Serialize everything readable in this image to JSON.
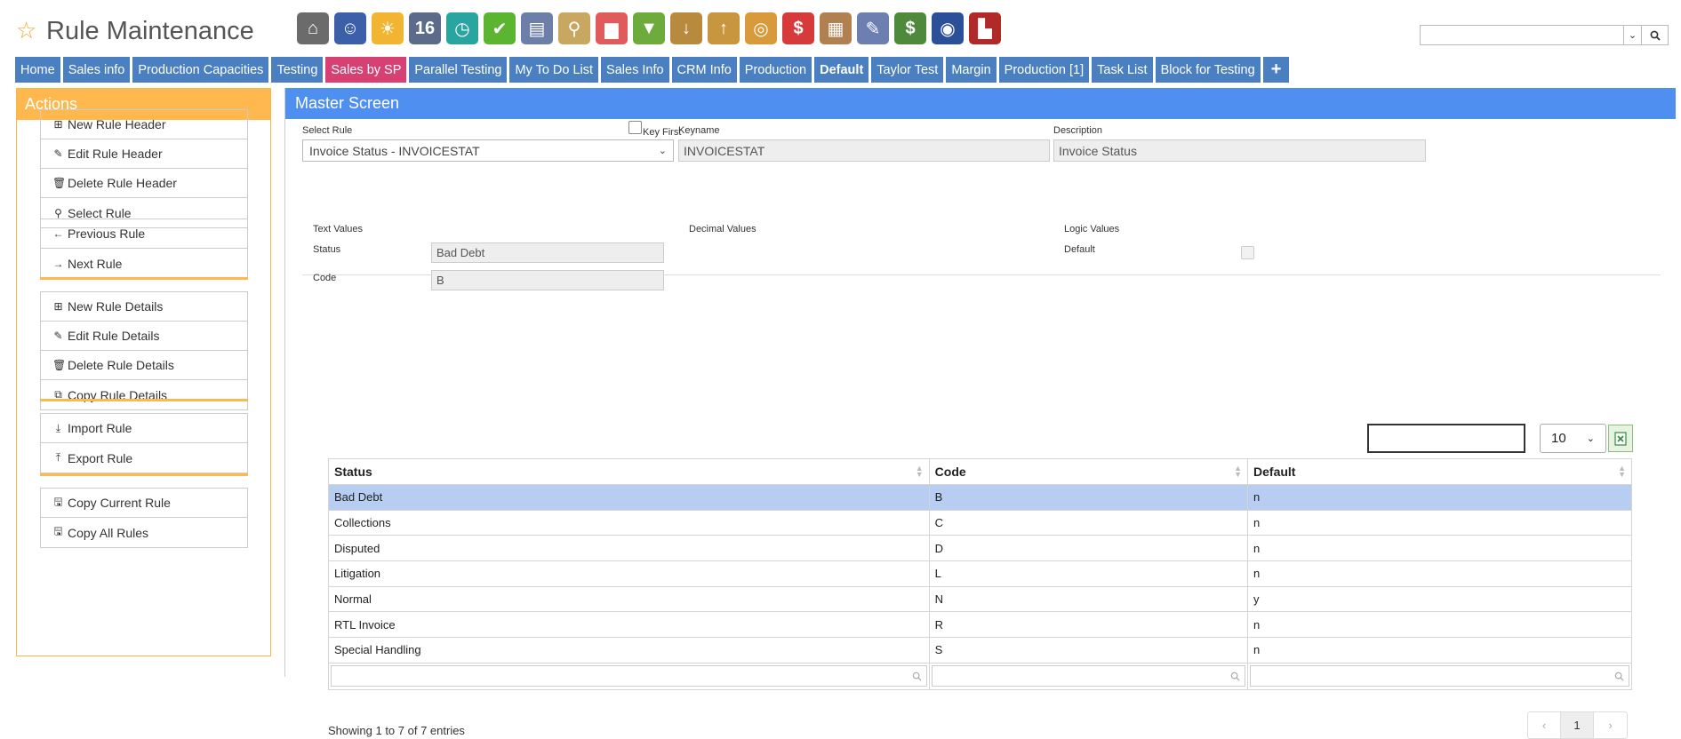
{
  "app": {
    "title": "Rule Maintenance"
  },
  "toolbar": [
    {
      "icon": "bank-icon",
      "bg": "#6b6b6b",
      "glyph": "⌂"
    },
    {
      "icon": "user-icon",
      "bg": "#3b5fa8",
      "glyph": "☺"
    },
    {
      "icon": "weather-icon",
      "bg": "#f2b531",
      "glyph": "☀"
    },
    {
      "icon": "calendar-icon",
      "bg": "#5c6b8a",
      "glyph": "16"
    },
    {
      "icon": "clock-icon",
      "bg": "#2aa4a0",
      "glyph": "◷"
    },
    {
      "icon": "checkmark-icon",
      "bg": "#5cb531",
      "glyph": "✔"
    },
    {
      "icon": "schedule-icon",
      "bg": "#6d7fa8",
      "glyph": "▤"
    },
    {
      "icon": "magnifier-icon",
      "bg": "#c8a860",
      "glyph": "⚲"
    },
    {
      "icon": "bus-icon",
      "bg": "#e05b5b",
      "glyph": "▆"
    },
    {
      "icon": "basket-icon",
      "bg": "#6cab3c",
      "glyph": "▼"
    },
    {
      "icon": "download-icon",
      "bg": "#b88a3d",
      "glyph": "↓"
    },
    {
      "icon": "upload-icon",
      "bg": "#c8963f",
      "glyph": "↑"
    },
    {
      "icon": "coins-icon",
      "bg": "#d89a3a",
      "glyph": "◎"
    },
    {
      "icon": "dollar-bubble-icon",
      "bg": "#d63a3a",
      "glyph": "$"
    },
    {
      "icon": "clipboard-icon",
      "bg": "#b08050",
      "glyph": "▦"
    },
    {
      "icon": "pencil-icon",
      "bg": "#6c7fb0",
      "glyph": "✎"
    },
    {
      "icon": "money-icon",
      "bg": "#4f8a3c",
      "glyph": "$"
    },
    {
      "icon": "compass-icon",
      "bg": "#2c4f9a",
      "glyph": "◉"
    },
    {
      "icon": "factory-icon",
      "bg": "#b02a2a",
      "glyph": "▙"
    }
  ],
  "search": {
    "placeholder": ""
  },
  "tabs": [
    {
      "label": "Home",
      "style": ""
    },
    {
      "label": "Sales info",
      "style": ""
    },
    {
      "label": "Production Capacities",
      "style": ""
    },
    {
      "label": "Testing",
      "style": ""
    },
    {
      "label": "Sales by SP",
      "style": "pink"
    },
    {
      "label": "Parallel Testing",
      "style": ""
    },
    {
      "label": "My To Do List",
      "style": ""
    },
    {
      "label": "Sales Info",
      "style": ""
    },
    {
      "label": "CRM Info",
      "style": ""
    },
    {
      "label": "Production",
      "style": ""
    },
    {
      "label": "Default",
      "style": "bold"
    },
    {
      "label": "Taylor Test",
      "style": ""
    },
    {
      "label": "Margin",
      "style": ""
    },
    {
      "label": "Production [1]",
      "style": ""
    },
    {
      "label": "Task List",
      "style": ""
    },
    {
      "label": "Block for Testing",
      "style": ""
    },
    {
      "label": "+",
      "style": "plus"
    }
  ],
  "actions": {
    "title": "Actions",
    "groups": [
      [
        {
          "label": "New Rule Header",
          "icon": "plus-square-icon",
          "glyph": "⊞"
        },
        {
          "label": "Edit Rule Header",
          "icon": "pencil-icon",
          "glyph": "✎"
        },
        {
          "label": "Delete Rule Header",
          "icon": "trash-icon",
          "glyph": "🗑"
        },
        {
          "label": "Select Rule",
          "icon": "pin-icon",
          "glyph": "⚲"
        }
      ],
      [
        {
          "label": "Previous Rule",
          "icon": "arrow-left-icon",
          "glyph": "←"
        },
        {
          "label": "Next Rule",
          "icon": "arrow-right-icon",
          "glyph": "→"
        }
      ],
      [
        {
          "label": "New Rule Details",
          "icon": "plus-square-icon",
          "glyph": "⊞"
        },
        {
          "label": "Edit Rule Details",
          "icon": "pencil-icon",
          "glyph": "✎"
        },
        {
          "label": "Delete Rule Details",
          "icon": "trash-icon",
          "glyph": "🗑"
        },
        {
          "label": "Copy Rule Details",
          "icon": "copy-icon",
          "glyph": "⧉"
        }
      ],
      [
        {
          "label": "Import Rule",
          "icon": "download-icon",
          "glyph": "⤓"
        },
        {
          "label": "Export Rule",
          "icon": "upload-icon",
          "glyph": "⤒"
        }
      ],
      [
        {
          "label": "Copy Current Rule",
          "icon": "save-icon",
          "glyph": "🖫"
        },
        {
          "label": "Copy All Rules",
          "icon": "save-icon",
          "glyph": "🖫"
        }
      ]
    ]
  },
  "master": {
    "title": "Master Screen",
    "select_rule_label": "Select Rule",
    "select_rule_value": "Invoice Status - INVOICESTAT",
    "key_first_label": "Key First",
    "keyname_label": "Keyname",
    "keyname_value": "INVOICESTAT",
    "description_label": "Description",
    "description_value": "Invoice Status",
    "text_values_label": "Text Values",
    "decimal_values_label": "Decimal Values",
    "logic_values_label": "Logic Values",
    "status_label": "Status",
    "status_value": "Bad Debt",
    "code_label": "Code",
    "code_value": "B",
    "default_label": "Default"
  },
  "table": {
    "page_length": "10",
    "columns": [
      "Status",
      "Code",
      "Default"
    ],
    "rows": [
      [
        "Bad Debt",
        "B",
        "n"
      ],
      [
        "Collections",
        "C",
        "n"
      ],
      [
        "Disputed",
        "D",
        "n"
      ],
      [
        "Litigation",
        "L",
        "n"
      ],
      [
        "Normal",
        "N",
        "y"
      ],
      [
        "RTL Invoice",
        "R",
        "n"
      ],
      [
        "Special Handling",
        "S",
        "n"
      ]
    ],
    "selected_row": 0,
    "info": "Showing 1 to 7 of 7 entries",
    "pagination": {
      "prev": "‹",
      "current": "1",
      "next": "›"
    }
  }
}
